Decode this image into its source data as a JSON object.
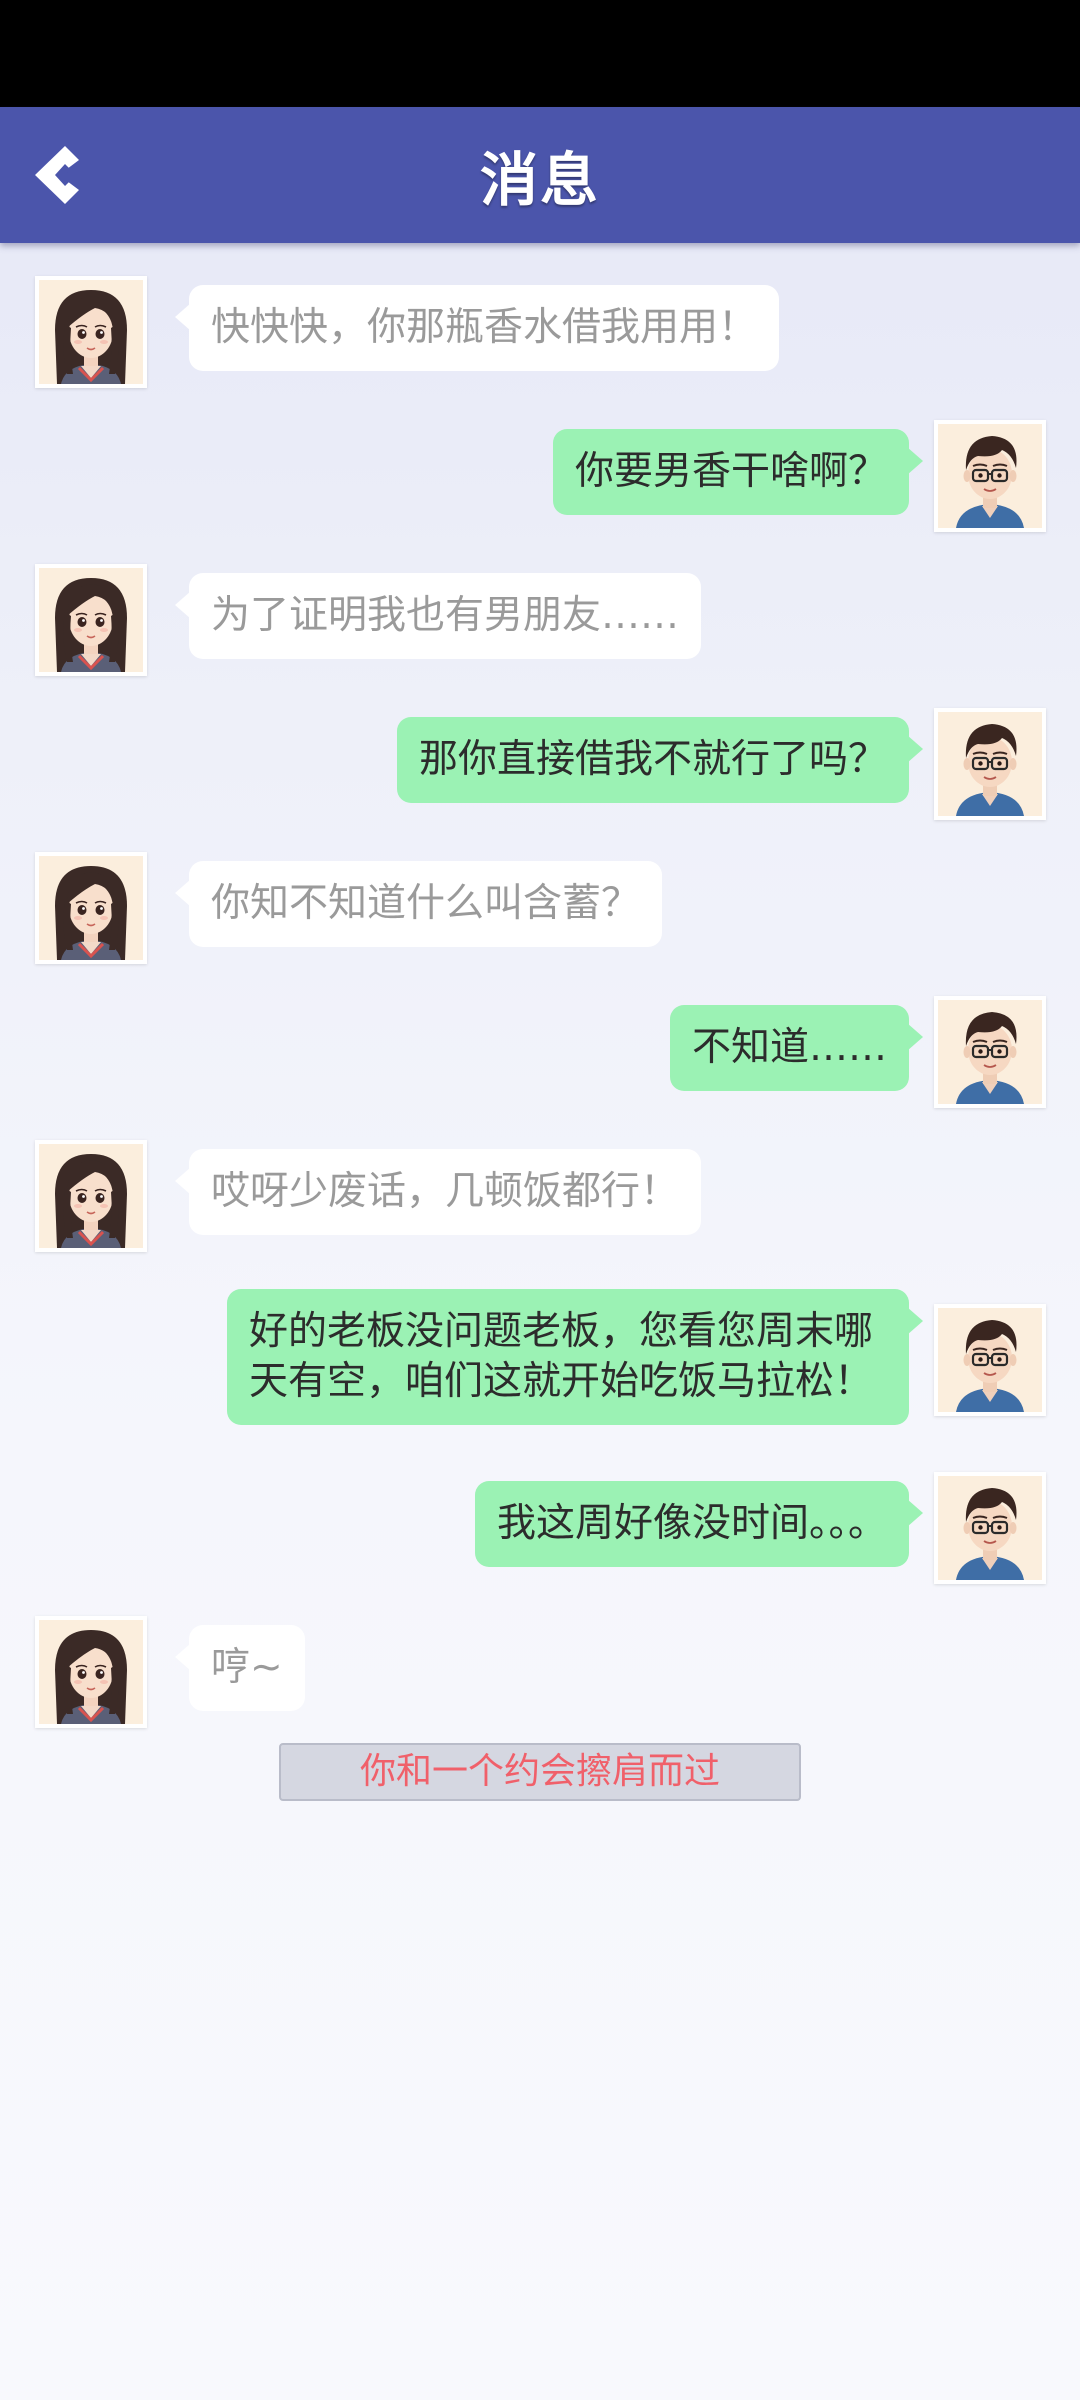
{
  "header": {
    "title": "消息",
    "back_icon": "back-chevron-icon"
  },
  "colors": {
    "header_bg": "#4b55ab",
    "incoming_bubble": "#ffffff",
    "outgoing_bubble": "#9bf2b4",
    "notice_text": "#f0606a"
  },
  "messages": [
    {
      "from": "girl",
      "text": "快快快，你那瓶香水借我用用！"
    },
    {
      "from": "me",
      "text": "你要男香干啥啊？"
    },
    {
      "from": "girl",
      "text": "为了证明我也有男朋友……"
    },
    {
      "from": "me",
      "text": "那你直接借我不就行了吗？"
    },
    {
      "from": "girl",
      "text": "你知不知道什么叫含蓄？"
    },
    {
      "from": "me",
      "text": "不知道……"
    },
    {
      "from": "girl",
      "text": "哎呀少废话，几顿饭都行！"
    },
    {
      "from": "me",
      "text": "好的老板没问题老板，您看您周末哪天有空，咱们这就开始吃饭马拉松！"
    },
    {
      "from": "me",
      "text": "我这周好像没时间。。。"
    },
    {
      "from": "girl",
      "text": "哼~"
    }
  ],
  "notice": {
    "text": "你和一个约会擦肩而过"
  }
}
